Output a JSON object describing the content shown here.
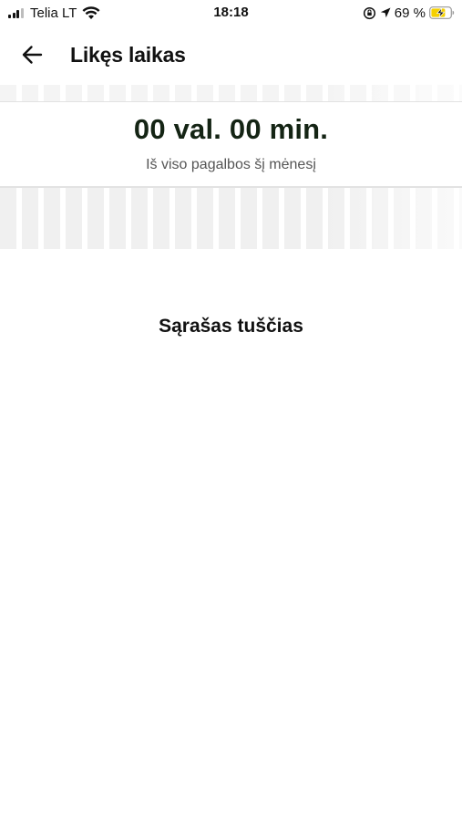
{
  "status_bar": {
    "carrier": "Telia LT",
    "time": "18:18",
    "battery_percent": "69 %",
    "icons": [
      "signal-icon",
      "wifi-icon",
      "rotation-lock-icon",
      "location-arrow-icon",
      "battery-charging-icon"
    ]
  },
  "header": {
    "back_icon": "arrow-left-icon",
    "title": "Likęs laikas"
  },
  "summary": {
    "time_value": "00 val. 00 min.",
    "caption": "Iš viso pagalbos šį mėnesį"
  },
  "list": {
    "empty_text": "Sąrašas tuščias",
    "items": []
  },
  "colors": {
    "title_text": "#111111",
    "time_value": "#142414",
    "caption_text": "#555555",
    "stripe": "#f0f0f0",
    "battery_charging": "#f5d000"
  }
}
